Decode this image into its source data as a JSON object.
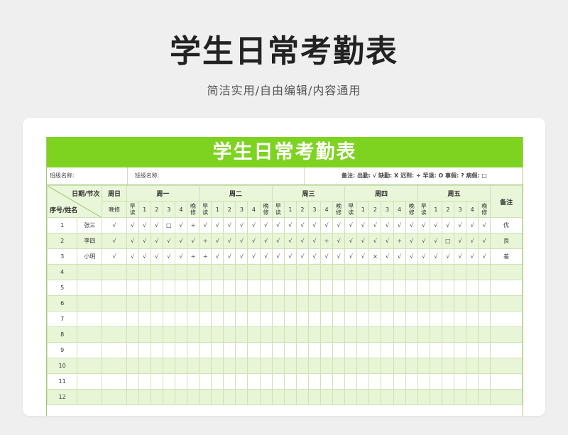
{
  "page": {
    "title": "学生日常考勤表",
    "subtitle": "简洁实用/自由编辑/内容通用"
  },
  "sheet": {
    "title": "学生日常考勤表",
    "class_label": "班级名称:",
    "class_label2": "班级名称:",
    "legend": "备注: 出勤: √ 缺勤: X 迟到: ÷ 早退: O 事假: ? 病假: □",
    "corner_top": "日期/节次",
    "corner_bottom": "序号/姓名",
    "sunday": "周日",
    "days": [
      "周一",
      "周二",
      "周三",
      "周四",
      "周五"
    ],
    "remark_header": "备注",
    "evening": "晚修",
    "morning": "早读",
    "periods": [
      "1",
      "2",
      "3",
      "4"
    ],
    "accent": "#7ed321",
    "header_bg": "#e9f6d9",
    "alt_row_bg": "#e8f5d6"
  },
  "rows": [
    {
      "no": "1",
      "name": "张三",
      "cells": [
        "√",
        "√",
        "√",
        "√",
        "□",
        "√",
        "÷",
        "√",
        "√",
        "√",
        "√",
        "√",
        "√",
        "√",
        "√",
        "√",
        "√",
        "√",
        "√",
        "√",
        "√",
        "√",
        "√",
        "√",
        "√",
        "√",
        "√",
        "√",
        "√",
        "√",
        "√",
        "√",
        "√",
        "√"
      ],
      "remark": "优"
    },
    {
      "no": "2",
      "name": "李四",
      "cells": [
        "√",
        "√",
        "√",
        "√",
        "√",
        "√",
        "√",
        "÷",
        "√",
        "√",
        "√",
        "√",
        "√",
        "√",
        "√",
        "√",
        "√",
        "÷",
        "√",
        "√",
        "√",
        "√",
        "√",
        "÷",
        "√",
        "√",
        "√",
        "□",
        "√",
        "√",
        "√",
        "√",
        "√",
        "√"
      ],
      "remark": "良"
    },
    {
      "no": "3",
      "name": "小明",
      "cells": [
        "√",
        "√",
        "√",
        "√",
        "√",
        "√",
        "÷",
        "÷",
        "√",
        "√",
        "√",
        "√",
        "√",
        "√",
        "√",
        "√",
        "√",
        "√",
        "√",
        "√",
        "√",
        "×",
        "√",
        "√",
        "√",
        "√",
        "√",
        "√",
        "√",
        "√",
        "√",
        "√",
        "√",
        "√"
      ],
      "remark": "差"
    },
    {
      "no": "4",
      "name": "",
      "cells": [],
      "remark": ""
    },
    {
      "no": "5",
      "name": "",
      "cells": [],
      "remark": ""
    },
    {
      "no": "6",
      "name": "",
      "cells": [],
      "remark": ""
    },
    {
      "no": "7",
      "name": "",
      "cells": [],
      "remark": ""
    },
    {
      "no": "8",
      "name": "",
      "cells": [],
      "remark": ""
    },
    {
      "no": "9",
      "name": "",
      "cells": [],
      "remark": ""
    },
    {
      "no": "10",
      "name": "",
      "cells": [],
      "remark": ""
    },
    {
      "no": "11",
      "name": "",
      "cells": [],
      "remark": ""
    },
    {
      "no": "12",
      "name": "",
      "cells": [],
      "remark": ""
    }
  ]
}
